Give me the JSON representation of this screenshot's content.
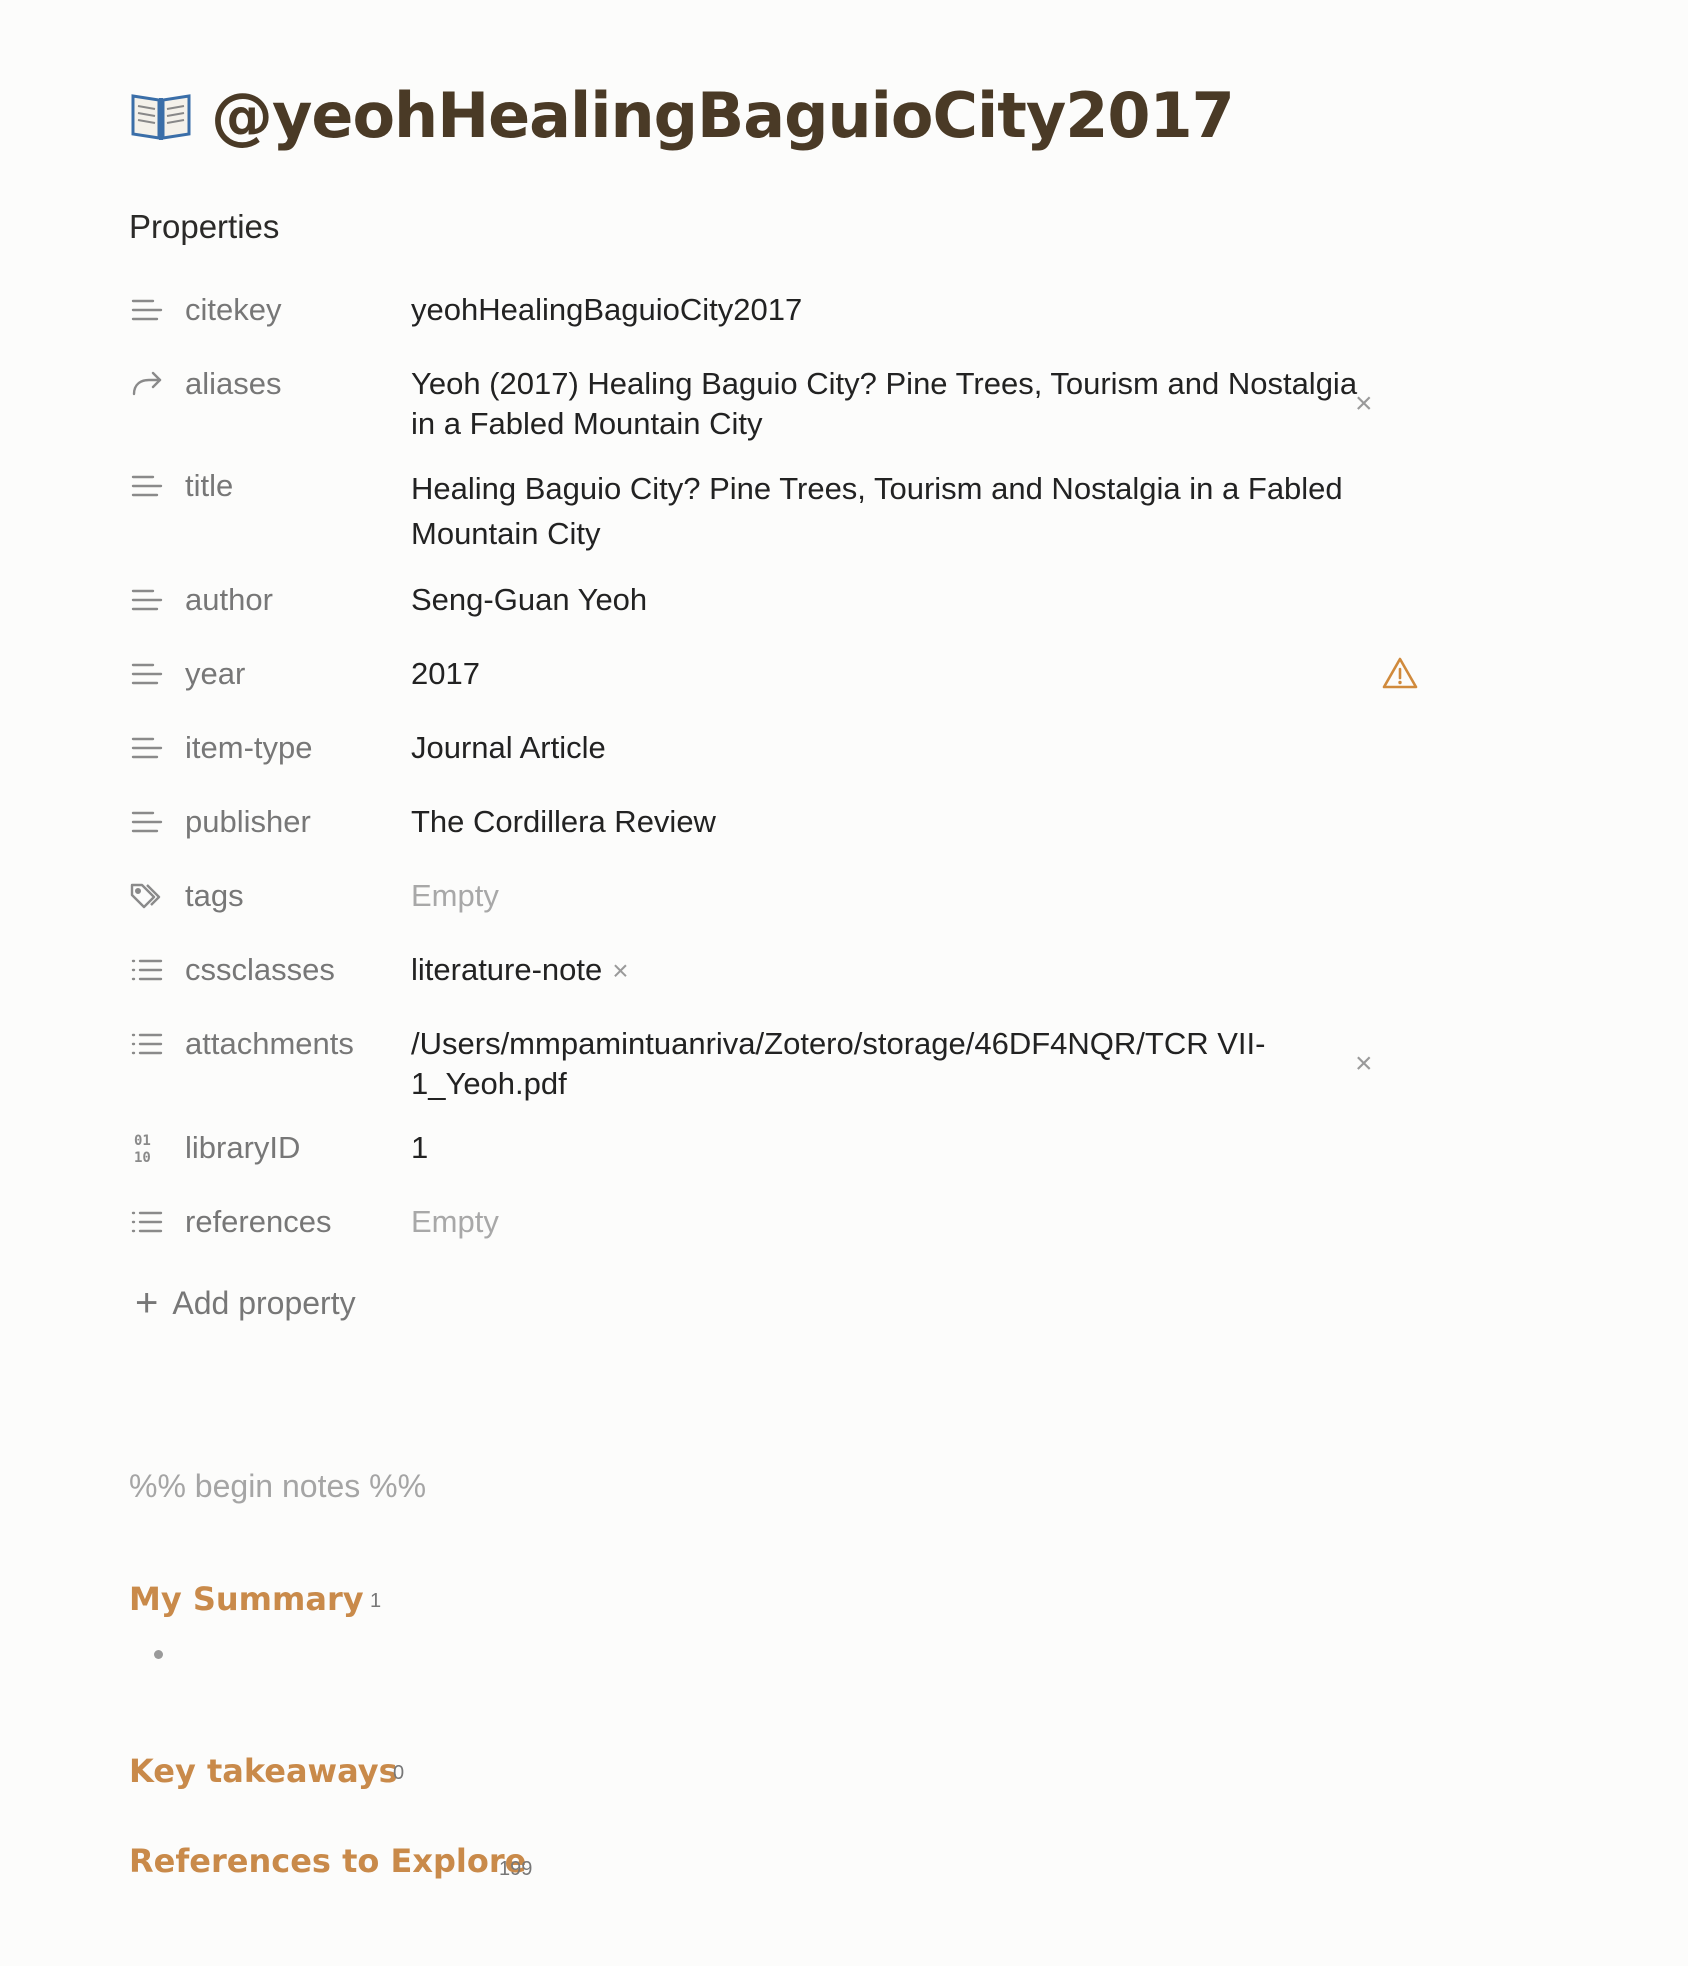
{
  "note": {
    "title": "@yeohHealingBaguioCity2017",
    "title_icon": "open-book-emoji"
  },
  "properties": {
    "heading": "Properties",
    "rows": [
      {
        "key": "citekey",
        "icon": "text-lines-icon",
        "value": "yeohHealingBaguioCity2017"
      },
      {
        "key": "aliases",
        "icon": "forward-arrow-icon",
        "value": "Yeoh (2017) Healing Baguio City? Pine Trees, Tourism and Nostalgia in a Fabled Mountain City",
        "removable": true
      },
      {
        "key": "title",
        "icon": "text-lines-icon",
        "value": "Healing Baguio City? Pine Trees, Tourism and Nostalgia in a Fabled Mountain City"
      },
      {
        "key": "author",
        "icon": "text-lines-icon",
        "value": "Seng-Guan Yeoh"
      },
      {
        "key": "year",
        "icon": "text-lines-icon",
        "value": "2017",
        "warning": true
      },
      {
        "key": "item-type",
        "icon": "text-lines-icon",
        "value": "Journal Article"
      },
      {
        "key": "publisher",
        "icon": "text-lines-icon",
        "value": "The Cordillera Review"
      },
      {
        "key": "tags",
        "icon": "tags-icon",
        "value": "Empty",
        "empty": true
      },
      {
        "key": "cssclasses",
        "icon": "list-icon",
        "value": "literature-note",
        "chip_remove": "×"
      },
      {
        "key": "attachments",
        "icon": "list-icon",
        "value": "/Users/mmpamintuanriva/Zotero/storage/46DF4NQR/TCR VII-1_Yeoh.pdf",
        "removable": true
      },
      {
        "key": "libraryID",
        "icon": "binary-number-icon",
        "value": "1"
      },
      {
        "key": "references",
        "icon": "list-icon",
        "value": "Empty",
        "empty": true
      }
    ],
    "add_label": "Add property",
    "add_icon": "+",
    "remove_glyph": "×"
  },
  "body": {
    "comment": "%% begin notes %%",
    "sections": [
      {
        "heading": "My Summary",
        "count": "1"
      },
      {
        "heading": "Key takeaways",
        "count": "0"
      },
      {
        "heading": "References to Explore",
        "count": "199"
      }
    ]
  },
  "colors": {
    "title": "#4a3a26",
    "heading_accent": "#c98a4a",
    "warning": "#d08a3c",
    "muted": "#777777"
  }
}
